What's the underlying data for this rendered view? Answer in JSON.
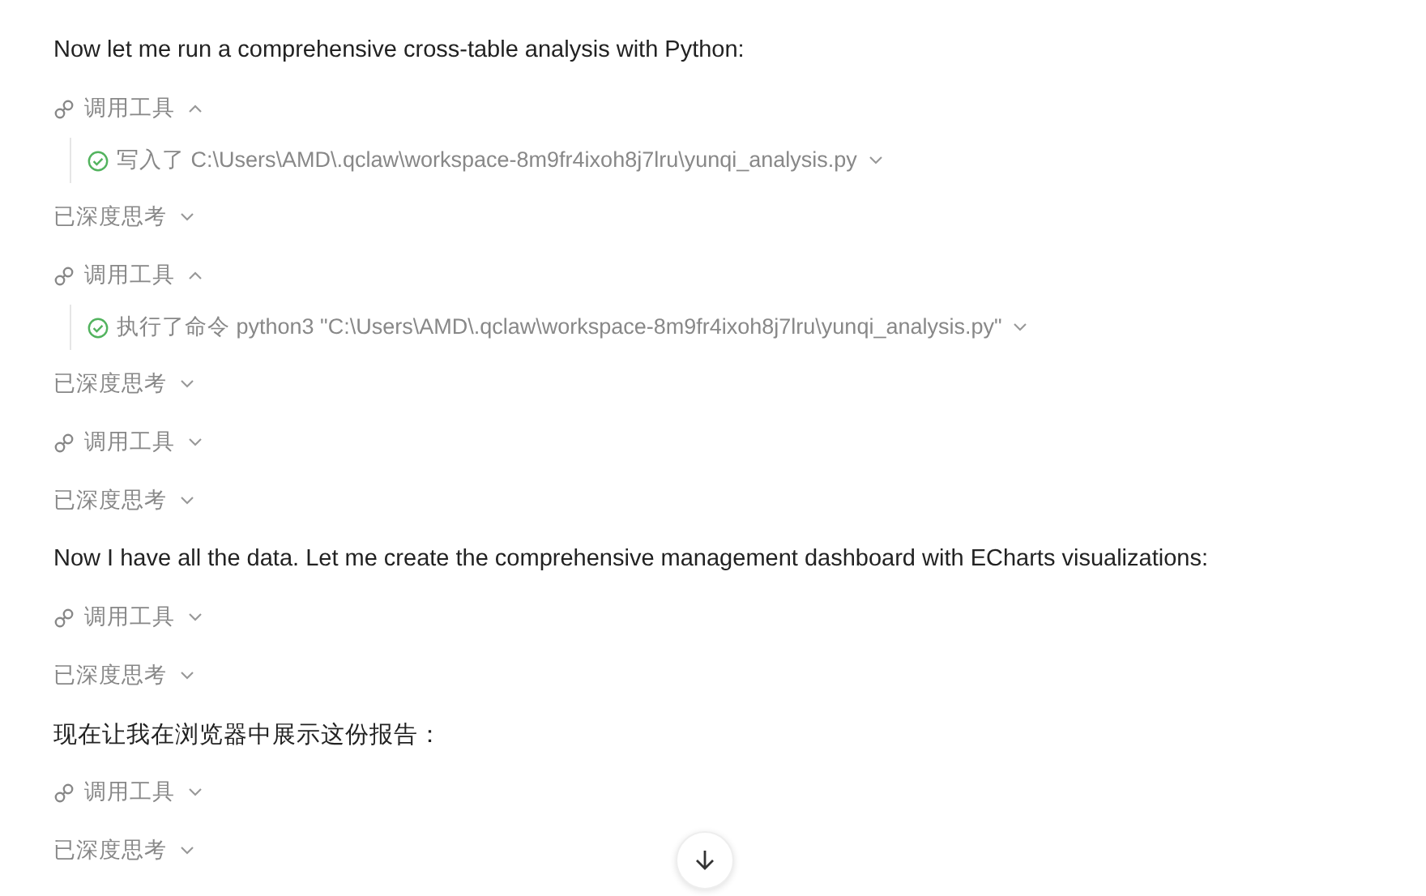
{
  "messages": [
    {
      "kind": "text",
      "text": "Now let me run a comprehensive cross-table analysis with Python:"
    },
    {
      "kind": "tool",
      "label": "调用工具",
      "expanded": true,
      "steps": [
        {
          "text": "写入了 C:\\Users\\AMD\\.qclaw\\workspace-8m9fr4ixoh8j7lru\\yunqi_analysis.py",
          "expanded": false
        }
      ]
    },
    {
      "kind": "thinking",
      "label": "已深度思考",
      "expanded": false
    },
    {
      "kind": "tool",
      "label": "调用工具",
      "expanded": true,
      "steps": [
        {
          "text": "执行了命令 python3 \"C:\\Users\\AMD\\.qclaw\\workspace-8m9fr4ixoh8j7lru\\yunqi_analysis.py\"",
          "expanded": false
        }
      ]
    },
    {
      "kind": "thinking",
      "label": "已深度思考",
      "expanded": false
    },
    {
      "kind": "tool",
      "label": "调用工具",
      "expanded": false
    },
    {
      "kind": "thinking",
      "label": "已深度思考",
      "expanded": false
    },
    {
      "kind": "text",
      "text": "Now I have all the data. Let me create the comprehensive management dashboard with ECharts visualizations:"
    },
    {
      "kind": "tool",
      "label": "调用工具",
      "expanded": false
    },
    {
      "kind": "thinking",
      "label": "已深度思考",
      "expanded": false
    },
    {
      "kind": "text",
      "text": "现在让我在浏览器中展示这份报告："
    },
    {
      "kind": "tool",
      "label": "调用工具",
      "expanded": false
    },
    {
      "kind": "thinking",
      "label": "已深度思考",
      "expanded": false
    }
  ]
}
